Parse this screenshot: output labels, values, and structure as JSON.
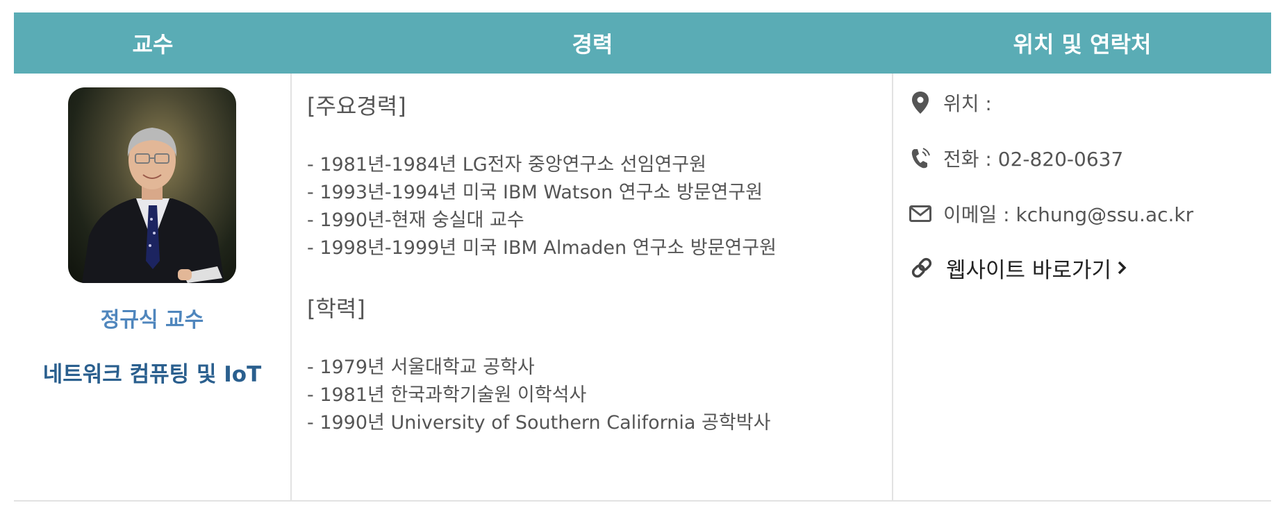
{
  "header": {
    "col_professor": "교수",
    "col_career": "경력",
    "col_contact": "위치 및 연락처"
  },
  "professor": {
    "name": "정규식 교수",
    "lab": "네트워크 컴퓨팅 및 IoT",
    "photo_alt": "professor-photo"
  },
  "career": {
    "main_title": "[주요경력]",
    "main_items": [
      "- 1981년-1984년 LG전자 중앙연구소 선임연구원",
      "- 1993년-1994년 미국 IBM Watson 연구소 방문연구원",
      "- 1990년-현재 숭실대 교수",
      "- 1998년-1999년 미국 IBM Almaden 연구소 방문연구원"
    ],
    "edu_title": "[학력]",
    "edu_items": [
      "- 1979년 서울대학교 공학사",
      "- 1981년 한국과학기술원 이학석사",
      "- 1990년 University of Southern California 공학박사"
    ]
  },
  "contact": {
    "location_label": "위치 :",
    "phone_label": "전화 : 02-820-0637",
    "email_label": "이메일 : kchung@ssu.ac.kr",
    "website_label": "웹사이트 바로가기",
    "icons": [
      "map-pin-icon",
      "phone-icon",
      "envelope-icon",
      "link-icon",
      "chevron-right-icon"
    ]
  },
  "colors": {
    "header_bg": "#5aacb5",
    "name_blue": "#4f86bd",
    "lab_blue": "#2a5f8e",
    "text_gray": "#555555",
    "border": "#e2e2e2"
  }
}
